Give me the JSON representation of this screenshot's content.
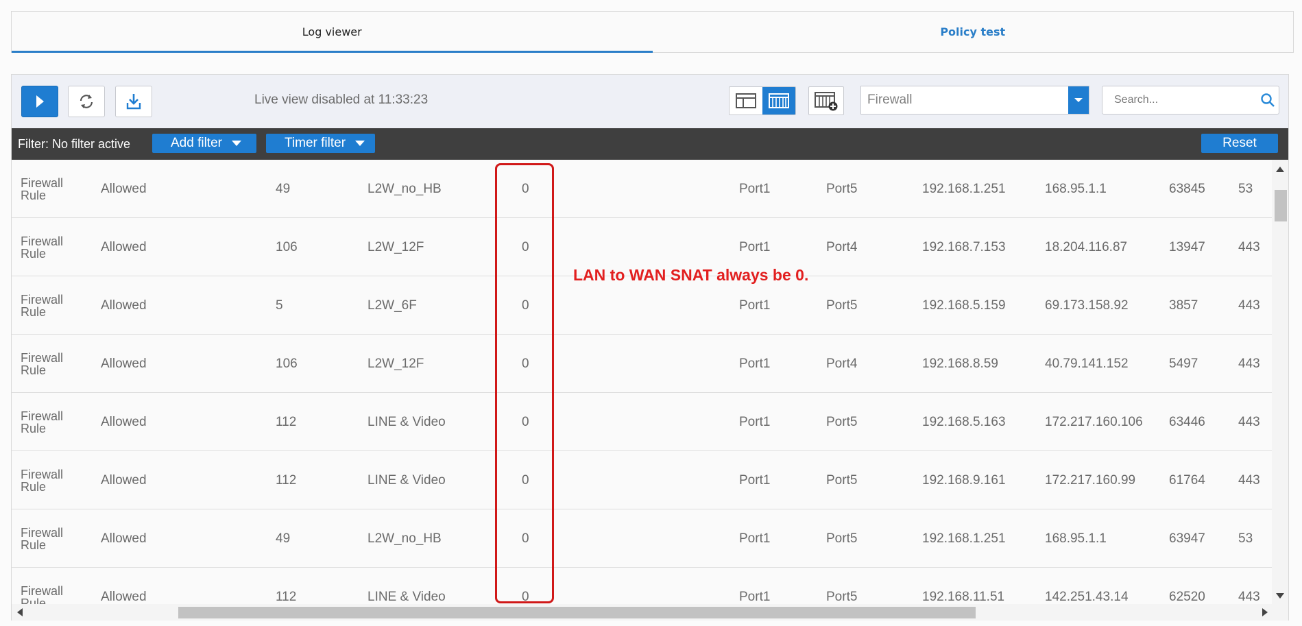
{
  "tabs": [
    {
      "label": "Log viewer",
      "active": true
    },
    {
      "label": "Policy test",
      "active": false
    }
  ],
  "toolbar": {
    "live_status": "Live view disabled at 11:33:23",
    "log_type_select": "Firewall",
    "search_placeholder": "Search..."
  },
  "filterbar": {
    "status": "Filter: No filter active",
    "add_filter_label": "Add filter",
    "timer_filter_label": "Timer filter",
    "reset_label": "Reset"
  },
  "table": {
    "rows": [
      {
        "type": "Firewall Rule",
        "action": "Allowed",
        "rule_id": "49",
        "rule_name": "L2W_no_HB",
        "snat": "0",
        "in_if": "Port1",
        "out_if": "Port5",
        "src_ip": "192.168.1.251",
        "dst_ip": "168.95.1.1",
        "src_port": "63845",
        "dst_port": "53"
      },
      {
        "type": "Firewall Rule",
        "action": "Allowed",
        "rule_id": "106",
        "rule_name": "L2W_12F",
        "snat": "0",
        "in_if": "Port1",
        "out_if": "Port4",
        "src_ip": "192.168.7.153",
        "dst_ip": "18.204.116.87",
        "src_port": "13947",
        "dst_port": "443"
      },
      {
        "type": "Firewall Rule",
        "action": "Allowed",
        "rule_id": "5",
        "rule_name": "L2W_6F",
        "snat": "0",
        "in_if": "Port1",
        "out_if": "Port5",
        "src_ip": "192.168.5.159",
        "dst_ip": "69.173.158.92",
        "src_port": "3857",
        "dst_port": "443"
      },
      {
        "type": "Firewall Rule",
        "action": "Allowed",
        "rule_id": "106",
        "rule_name": "L2W_12F",
        "snat": "0",
        "in_if": "Port1",
        "out_if": "Port4",
        "src_ip": "192.168.8.59",
        "dst_ip": "40.79.141.152",
        "src_port": "5497",
        "dst_port": "443"
      },
      {
        "type": "Firewall Rule",
        "action": "Allowed",
        "rule_id": "112",
        "rule_name": "LINE & Video",
        "snat": "0",
        "in_if": "Port1",
        "out_if": "Port5",
        "src_ip": "192.168.5.163",
        "dst_ip": "172.217.160.106",
        "src_port": "63446",
        "dst_port": "443"
      },
      {
        "type": "Firewall Rule",
        "action": "Allowed",
        "rule_id": "112",
        "rule_name": "LINE & Video",
        "snat": "0",
        "in_if": "Port1",
        "out_if": "Port5",
        "src_ip": "192.168.9.161",
        "dst_ip": "172.217.160.99",
        "src_port": "61764",
        "dst_port": "443"
      },
      {
        "type": "Firewall Rule",
        "action": "Allowed",
        "rule_id": "49",
        "rule_name": "L2W_no_HB",
        "snat": "0",
        "in_if": "Port1",
        "out_if": "Port5",
        "src_ip": "192.168.1.251",
        "dst_ip": "168.95.1.1",
        "src_port": "63947",
        "dst_port": "53"
      },
      {
        "type": "Firewall Rule",
        "action": "Allowed",
        "rule_id": "112",
        "rule_name": "LINE & Video",
        "snat": "0",
        "in_if": "Port1",
        "out_if": "Port5",
        "src_ip": "192.168.11.51",
        "dst_ip": "142.251.43.14",
        "src_port": "62520",
        "dst_port": "443"
      }
    ]
  },
  "annotation": {
    "text": "LAN to WAN SNAT always be 0.",
    "color": "#e21f1f"
  },
  "colors": {
    "accent": "#1f7dd1",
    "filterbar_bg": "#3f3f3f"
  },
  "icons": {
    "play": "play-icon",
    "refresh": "refresh-icon",
    "download": "download-icon",
    "search": "search-icon"
  }
}
